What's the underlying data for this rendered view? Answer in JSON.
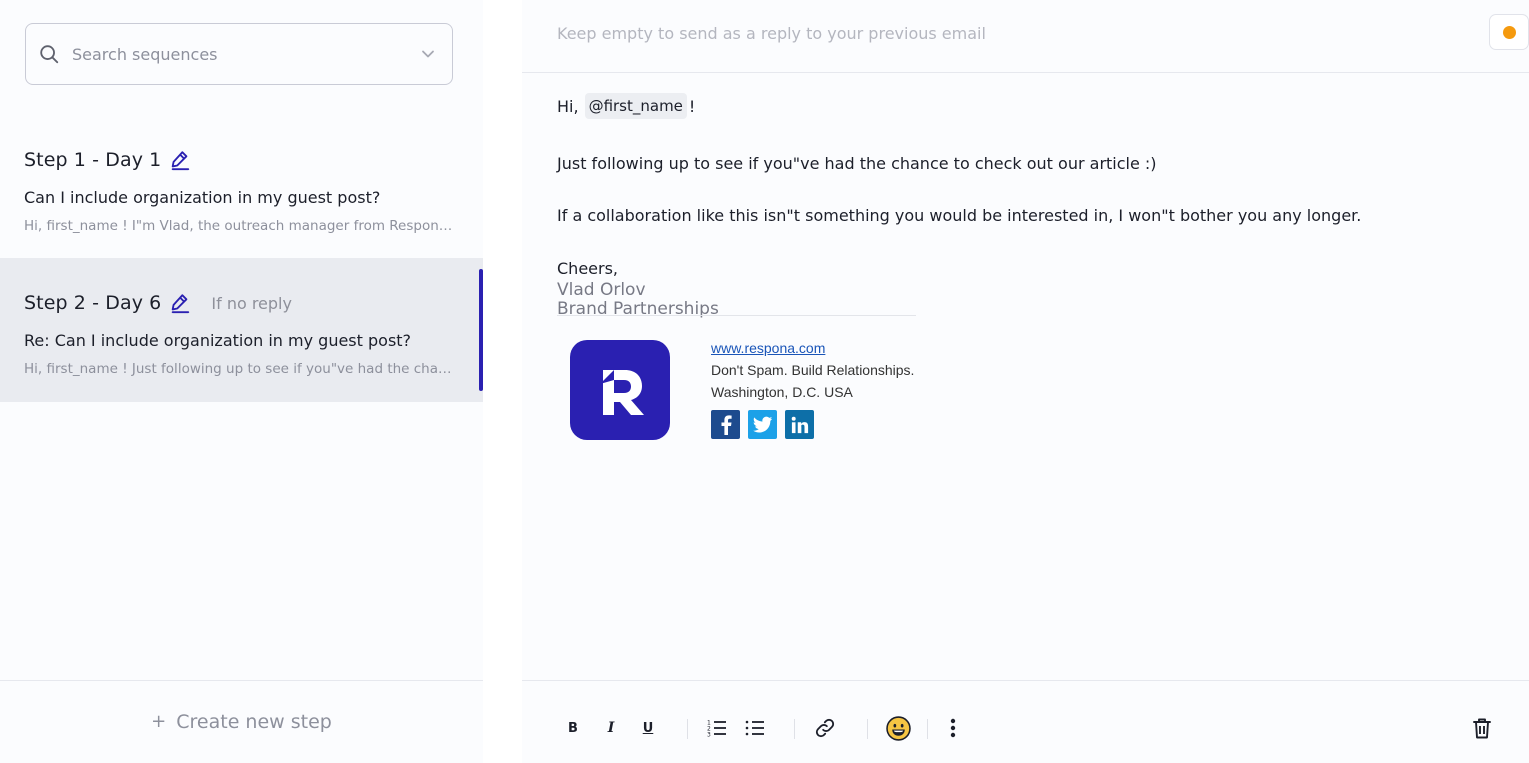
{
  "sidebar": {
    "search": {
      "placeholder": "Search sequences"
    },
    "steps": [
      {
        "title": "Step 1 - Day 1",
        "condition": "",
        "subject": "Can I include organization in my guest post?",
        "preview": "Hi, first_name ! I\"m Vlad, the outreach manager from Respona. I came across your website and wanted to reach out",
        "selected": false
      },
      {
        "title": "Step 2 - Day 6",
        "condition": "If no reply",
        "subject": "Re: Can I include organization in my guest post?",
        "preview": "Hi, first_name ! Just following up to see if you\"ve had the chance to check out our article :)",
        "selected": true
      }
    ],
    "create_step_label": "Create new step"
  },
  "editor": {
    "subject_placeholder": "Keep empty to send as a reply to your previous email",
    "status_color": "#f59a0e",
    "greeting_prefix": "Hi,",
    "variable": "@first_name",
    "greeting_suffix": "!",
    "paragraph_1": "Just following up to see if you\"ve had the chance to check out our article :)",
    "paragraph_2": "If a collaboration like this isn\"t something you would be interested in, I won\"t bother you any longer.",
    "closing": "Cheers,",
    "sender_name": "Vlad Orlov",
    "sender_role": "Brand Partnerships",
    "signature": {
      "website": "www.respona.com",
      "tagline": "Don't Spam. Build Relationships.",
      "location": "Washington, D.C. USA",
      "logo_color": "#2a20b1",
      "socials": [
        "facebook-icon",
        "twitter-icon",
        "linkedin-icon"
      ]
    }
  },
  "toolbar": {
    "bold_label": "B",
    "italic_label": "I",
    "underline_label": "U"
  },
  "colors": {
    "accent": "#2a20b1",
    "selected_bg": "#e9ebf0",
    "muted_text": "#8d909c"
  }
}
